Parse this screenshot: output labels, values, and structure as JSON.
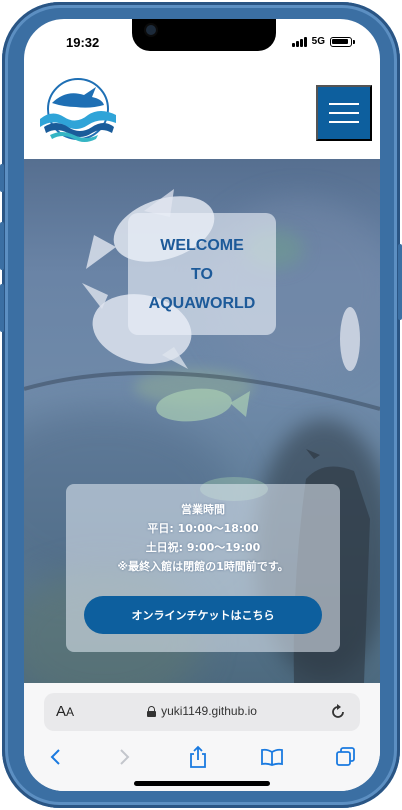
{
  "status_bar": {
    "time": "19:32",
    "network": "5G",
    "icons": [
      "signal-icon",
      "battery-icon"
    ]
  },
  "header": {
    "logo_icon": "aquaworld-logo-icon",
    "menu_icon": "hamburger-menu-icon"
  },
  "hero": {
    "welcome_lines": [
      "WELCOME",
      "TO",
      "AQUAWORLD"
    ],
    "info": {
      "title": "営業時間",
      "weekday": "平日: 10:00〜18:00",
      "weekend": "土日祝: 9:00〜19:00",
      "note": "※最終入館は閉館の1時間前です。"
    },
    "ticket_button": "オンラインチケットはこちら"
  },
  "browser": {
    "text_size_big": "A",
    "text_size_small": "A",
    "url": "yuki1149.github.io",
    "toolbar_icons": [
      "back-icon",
      "forward-icon",
      "share-icon",
      "bookmarks-icon",
      "tabs-icon"
    ]
  },
  "colors": {
    "brand": "#0d5f9e",
    "welcome_text": "#1d5a99",
    "frame": "#3b6fa3"
  }
}
